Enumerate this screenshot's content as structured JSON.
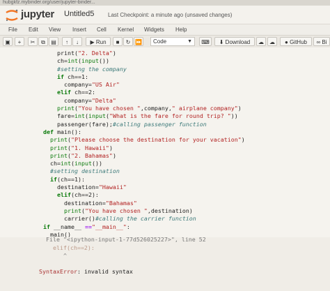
{
  "browser": {
    "url": "hubgkfz.mybinder.org/user/jupyter-binder..."
  },
  "header": {
    "brand": "jupyter",
    "notebook_name": "Untitled5",
    "checkpoint": "Last Checkpoint: a minute ago",
    "unsaved": "(unsaved changes)"
  },
  "menu": [
    "File",
    "Edit",
    "View",
    "Insert",
    "Cell",
    "Kernel",
    "Widgets",
    "Help"
  ],
  "toolbar": {
    "run_label": "Run",
    "cell_type": "Code",
    "download_label": "Download",
    "github_label": "GitHub",
    "binder_label": "Bi"
  },
  "code_lines": [
    [
      [
        "    print(",
        ""
      ],
      [
        "\"2. Delta\"",
        "str"
      ],
      [
        ")",
        ""
      ]
    ],
    [
      [
        "    ch=",
        ""
      ],
      [
        "int",
        "bi"
      ],
      [
        "(",
        ""
      ],
      [
        "input",
        "bi"
      ],
      [
        "())",
        ""
      ]
    ],
    [
      [
        "    #setting the company",
        "cm"
      ]
    ],
    [
      [
        "    ",
        ""
      ],
      [
        "if",
        "kw"
      ],
      [
        " ch==1:",
        ""
      ]
    ],
    [
      [
        "      company=",
        ""
      ],
      [
        "\"US Air\"",
        "str"
      ]
    ],
    [
      [
        "    ",
        ""
      ],
      [
        "elif",
        "kw"
      ],
      [
        " ch==2:",
        ""
      ]
    ],
    [
      [
        "      company=",
        ""
      ],
      [
        "\"Delta\"",
        "str"
      ]
    ],
    [
      [
        "    ",
        ""
      ],
      [
        "print",
        "bi"
      ],
      [
        "(",
        ""
      ],
      [
        "\"You have chosen \"",
        "str"
      ],
      [
        ",company,",
        ""
      ],
      [
        "\" airplane company\"",
        "str"
      ],
      [
        ")",
        ""
      ]
    ],
    [
      [
        "    fare=",
        ""
      ],
      [
        "int",
        "bi"
      ],
      [
        "(",
        ""
      ],
      [
        "input",
        "bi"
      ],
      [
        "(",
        ""
      ],
      [
        "\"What is the fare for round trip? \"",
        "str"
      ],
      [
        "))",
        ""
      ]
    ],
    [
      [
        "    passenger(fare);",
        ""
      ],
      [
        "#calling passenger function",
        "cm"
      ]
    ],
    [
      [
        "def",
        "kw"
      ],
      [
        " main():",
        ""
      ]
    ],
    [
      [
        "  ",
        ""
      ],
      [
        "print",
        "bi"
      ],
      [
        "(",
        ""
      ],
      [
        "\"Please choose the destination for your vacation\"",
        "str"
      ],
      [
        ")",
        ""
      ]
    ],
    [
      [
        "  ",
        ""
      ],
      [
        "print",
        "bi"
      ],
      [
        "(",
        ""
      ],
      [
        "\"1. Hawaii\"",
        "str"
      ],
      [
        ")",
        ""
      ]
    ],
    [
      [
        "  ",
        ""
      ],
      [
        "print",
        "bi"
      ],
      [
        "(",
        ""
      ],
      [
        "\"2. Bahamas\"",
        "str"
      ],
      [
        ")",
        ""
      ]
    ],
    [
      [
        "  ch=",
        ""
      ],
      [
        "int",
        "bi"
      ],
      [
        "(",
        ""
      ],
      [
        "input",
        "bi"
      ],
      [
        "())",
        ""
      ]
    ],
    [
      [
        "  #setting destination",
        "cm"
      ]
    ],
    [
      [
        "  ",
        ""
      ],
      [
        "if",
        "kw"
      ],
      [
        "(ch==1):",
        ""
      ]
    ],
    [
      [
        "    destination=",
        ""
      ],
      [
        "\"Hawaii\"",
        "str"
      ]
    ],
    [
      [
        "    ",
        ""
      ],
      [
        "elif",
        "kw"
      ],
      [
        "(ch==2):",
        ""
      ]
    ],
    [
      [
        "      destination=",
        ""
      ],
      [
        "\"Bahamas\"",
        "str"
      ]
    ],
    [
      [
        "      ",
        ""
      ],
      [
        "print",
        "bi"
      ],
      [
        "(",
        ""
      ],
      [
        "\"You have chosen \"",
        "str"
      ],
      [
        ",destination)",
        ""
      ]
    ],
    [
      [
        "      carrier()",
        ""
      ],
      [
        "#calling the carrier function",
        "cm"
      ]
    ],
    [
      [
        "if",
        "kw"
      ],
      [
        " __name__ ",
        ""
      ],
      [
        "==",
        "op"
      ],
      [
        "\"__main__\"",
        "str"
      ],
      [
        ":",
        ""
      ]
    ],
    [
      [
        "  main()",
        ""
      ]
    ]
  ],
  "traceback": [
    [
      [
        "  File ",
        "tb-file"
      ],
      [
        "\"<ipython-input-1-77d526025227>\"",
        "tb-file"
      ],
      [
        ", line 52",
        "tb-file"
      ]
    ],
    [
      [
        "    elif(ch==2):",
        "tb-code"
      ]
    ],
    [
      [
        "       ^",
        "tb-file"
      ]
    ],
    [
      [
        "",
        ""
      ]
    ],
    [
      [
        "SyntaxError",
        "err"
      ],
      [
        ": invalid syntax",
        ""
      ]
    ]
  ]
}
